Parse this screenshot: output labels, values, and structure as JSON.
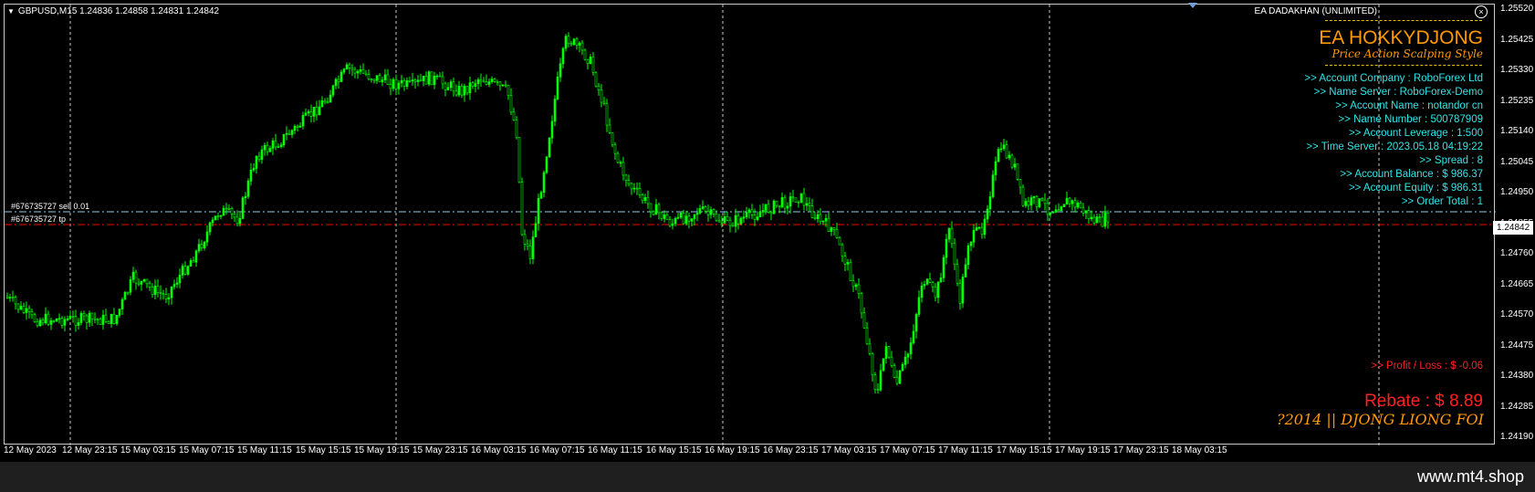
{
  "chart": {
    "title": "GBPUSD,M15  1.24836 1.24858 1.24831 1.24842",
    "current_price": "1.24842",
    "price_ticks": [
      "1.25520",
      "1.25425",
      "1.25330",
      "1.25235",
      "1.25140",
      "1.25045",
      "1.24950",
      "1.24855",
      "1.24760",
      "1.24665",
      "1.24570",
      "1.24475",
      "1.24380",
      "1.24285",
      "1.24190"
    ],
    "time_ticks": [
      "12 May 2023",
      "12 May 23:15",
      "15 May 03:15",
      "15 May 07:15",
      "15 May 11:15",
      "15 May 15:15",
      "15 May 19:15",
      "15 May 23:15",
      "16 May 03:15",
      "16 May 07:15",
      "16 May 11:15",
      "16 May 15:15",
      "16 May 19:15",
      "16 May 23:15",
      "17 May 03:15",
      "17 May 07:15",
      "17 May 11:15",
      "17 May 15:15",
      "17 May 19:15",
      "17 May 23:15",
      "18 May 03:15"
    ],
    "order_sell_label": "#676735727 sell 0.01",
    "order_tp_label": "#676735727 tp",
    "colors": {
      "candle": "#00ff00",
      "sell_line": "#87ceeb",
      "tp_line": "#ff0000",
      "grid": "#c8c8c8"
    }
  },
  "ea_panel": {
    "header": "EA DADAKHAN (UNLIMITED)",
    "close_icon": "close-circle-icon",
    "brand": "EA HOKKYDJONG",
    "tagline": "Price Action Scalping Style",
    "info": [
      ">> Account Company : RoboForex Ltd",
      ">> Name Server  : RoboForex-Demo",
      ">> Account Name  : notandor cn",
      ">> Name Number  : 500787909",
      ">> Account Leverage  : 1:500",
      ">> Time Server  : 2023.05.18 04:19:22",
      ">> Spread  : 8",
      ">> Account Balance  : $ 986.37",
      ">> Account Equity  : $ 986.31",
      ">> Order Total  : 1"
    ],
    "profit_loss": ">> Profit / Loss  : $ -0.06",
    "rebate": "Rebate  : $ 8.89",
    "marquee": "?2014 || DJONG LIONG FOI",
    "colors": {
      "brand": "#ff9900",
      "info": "#2ee6e6",
      "alert": "#ff2020"
    }
  },
  "footer": {
    "site": "www.mt4.shop"
  }
}
